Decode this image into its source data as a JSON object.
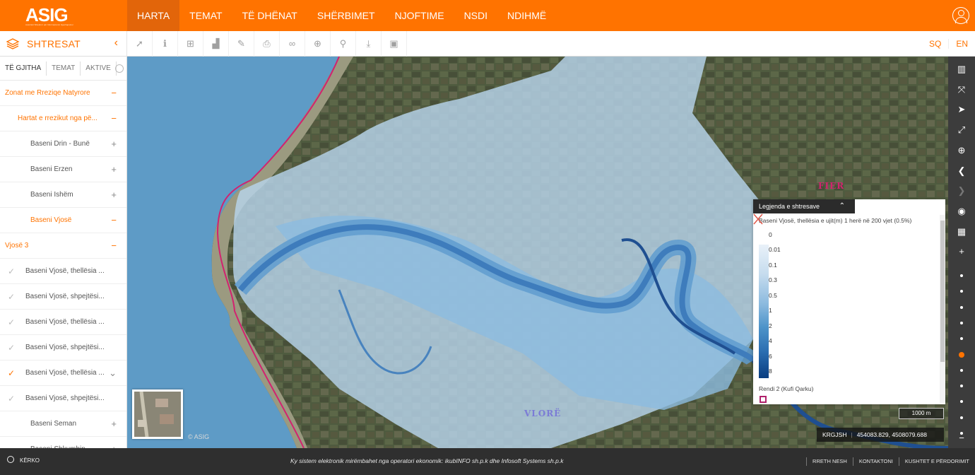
{
  "header": {
    "logo_text": "ASIG",
    "logo_subtext": "Autoriteti Shtetëror për Informacionin Gjeohapsinor",
    "nav": [
      {
        "label": "HARTA",
        "active": true
      },
      {
        "label": "TEMAT"
      },
      {
        "label": "TË DHËNAT"
      },
      {
        "label": "SHËRBIMET"
      },
      {
        "label": "NJOFTIME"
      },
      {
        "label": "NSDI"
      },
      {
        "label": "NDIHMË"
      }
    ],
    "user_icon": "user-circle-icon"
  },
  "toolbar": {
    "layers_title": "SHTRESAT",
    "layers_icon": "layers-icon",
    "collapse_icon": "chevron-left-icon",
    "tools": [
      {
        "icon": "pointer-icon",
        "glyph": "➚"
      },
      {
        "icon": "info-icon",
        "glyph": "ℹ"
      },
      {
        "icon": "add-box-icon",
        "glyph": "⊞"
      },
      {
        "icon": "chart-icon",
        "glyph": "▟"
      },
      {
        "icon": "edit-icon",
        "glyph": "✎"
      },
      {
        "icon": "print-icon",
        "glyph": "⎙"
      },
      {
        "icon": "link-icon",
        "glyph": "∞"
      },
      {
        "icon": "add-circle-icon",
        "glyph": "⊕"
      },
      {
        "icon": "search-icon",
        "glyph": "⚲"
      },
      {
        "icon": "download-icon",
        "glyph": "⤓"
      },
      {
        "icon": "image-icon",
        "glyph": "▣"
      }
    ],
    "languages": [
      "SQ",
      "EN"
    ]
  },
  "sidebar": {
    "tabs": [
      "TË GJITHA",
      "TEMAT",
      "AKTIVE"
    ],
    "rows": [
      {
        "label": "Zonat me Rreziqe Natyrore",
        "indent": 7,
        "cat": true,
        "toggle": "−"
      },
      {
        "label": "Hartat e rrezikut nga pë...",
        "indent": 25,
        "cat": true,
        "toggle": "−"
      },
      {
        "label": "Baseni Drin - Bunë",
        "indent": 43,
        "toggle": "+"
      },
      {
        "label": "Baseni Erzen",
        "indent": 43,
        "toggle": "+"
      },
      {
        "label": "Baseni Ishëm",
        "indent": 43,
        "toggle": "+"
      },
      {
        "label": "Baseni Vjosë",
        "indent": 43,
        "cat": true,
        "toggle": "−"
      },
      {
        "label": "Vjosë 3",
        "indent": 7,
        "cat": true,
        "toggle": "−"
      },
      {
        "label": "Baseni Vjosë, thellësia ...",
        "indent": 36,
        "check": "✓"
      },
      {
        "label": "Baseni Vjosë, shpejtësi...",
        "indent": 36,
        "check": "✓"
      },
      {
        "label": "Baseni Vjosë, thellësia ...",
        "indent": 36,
        "check": "✓"
      },
      {
        "label": "Baseni Vjosë, shpejtësi...",
        "indent": 36,
        "check": "✓"
      },
      {
        "label": "Baseni Vjosë, thellësia ...",
        "indent": 36,
        "check": "✓",
        "checked": true,
        "toggle": "⌄"
      },
      {
        "label": "Baseni Vjosë, shpejtësi...",
        "indent": 36,
        "check": "✓"
      },
      {
        "label": "Baseni Seman",
        "indent": 43,
        "toggle": "+"
      },
      {
        "label": "Baseni Shkumbin",
        "indent": 43,
        "toggle": "+"
      }
    ]
  },
  "map": {
    "labels": [
      {
        "text": "FIER",
        "color": "#d2226f"
      },
      {
        "text": "VLORË",
        "color": "#7b7bd6"
      }
    ],
    "attribution": "© ASIG",
    "scale": "1000 m",
    "crs": "KRGJSH",
    "separator": "|",
    "coordinates": "454083.829, 4508079.688",
    "flood_colors": [
      "#b7d4ec",
      "#8cbbe0",
      "#5f9ccf",
      "#3e7cbc",
      "#1f4f91"
    ],
    "sea_color": "#5e9bc6"
  },
  "legend": {
    "title": "Legjenda e shtresave",
    "arrow": "⌃",
    "layer_name": "Baseni Vjosë, thellësia e ujit(m) 1 herë në 200 vjet (0.5%)",
    "nodata_value": "0",
    "ramp_values": [
      "0.01",
      "0.1",
      "0.3",
      "0.5",
      "1",
      "2",
      "4",
      "6",
      "8"
    ],
    "second_layer": "Rendi 2 (Kufi Qarku)",
    "second_layer_color": "#b0216b"
  },
  "rail": {
    "buttons": [
      {
        "icon": "map-icon",
        "glyph": "▥"
      },
      {
        "icon": "fullscreen-icon",
        "glyph": "⤧"
      },
      {
        "icon": "locate-icon",
        "glyph": "➤"
      },
      {
        "icon": "expand-icon",
        "glyph": "⤢"
      },
      {
        "icon": "zoom-extent-icon",
        "glyph": "⊕"
      },
      {
        "icon": "back-icon",
        "glyph": "❮"
      },
      {
        "icon": "forward-icon",
        "glyph": "❯",
        "dim": true
      },
      {
        "icon": "globe-icon",
        "glyph": "◉"
      },
      {
        "icon": "grid-icon",
        "glyph": "▦"
      },
      {
        "icon": "zoom-in-icon",
        "glyph": "+"
      }
    ],
    "zoom_out": "−",
    "zoom_levels": 11,
    "current_zoom_level": 5
  },
  "footer": {
    "search_label": "KËRKO",
    "operator_text": "Ky sistem elektronik mirëmbahet nga operatori ekonomik: ikubINFO sh.p.k dhe Infosoft Systems sh.p.k",
    "links": [
      "RRETH NESH",
      "KONTAKTONI",
      "KUSHTET E PËRDORIMIT"
    ]
  }
}
